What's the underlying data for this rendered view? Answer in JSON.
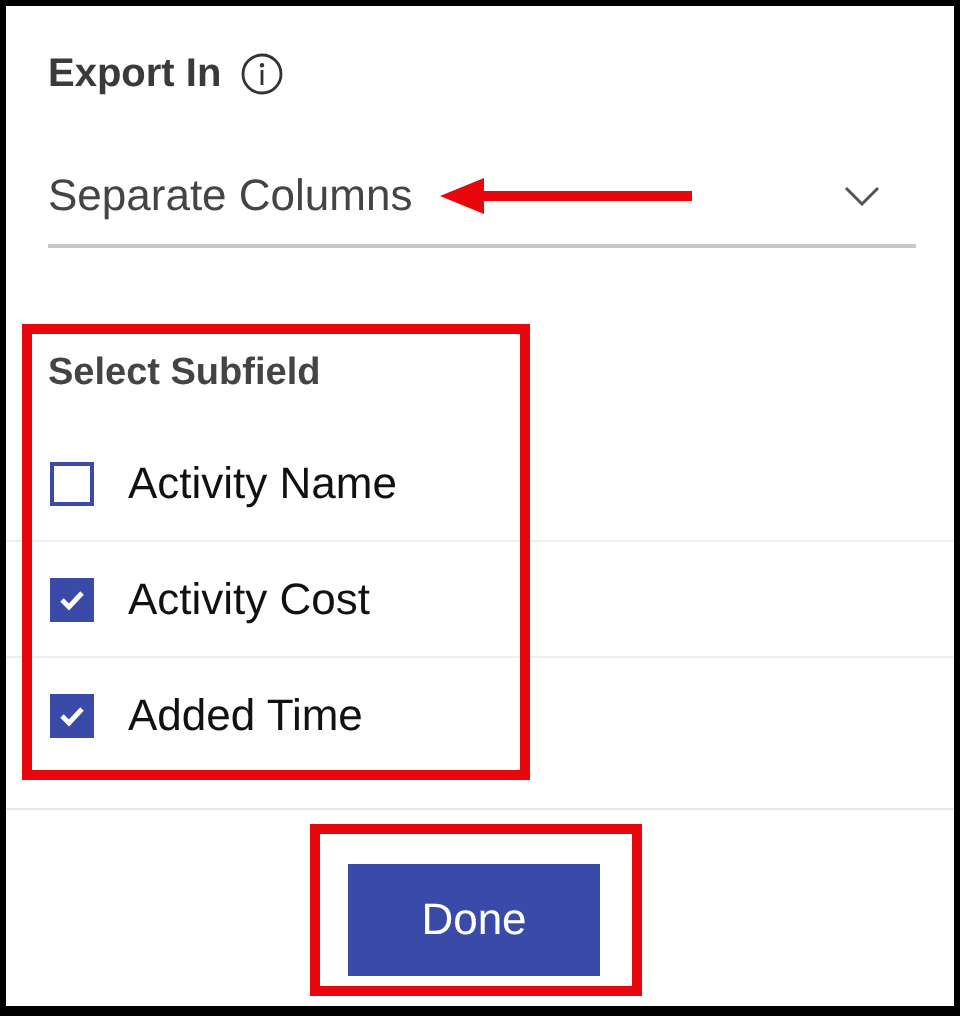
{
  "export_in": {
    "label": "Export In",
    "value": "Separate Columns"
  },
  "subfield": {
    "title": "Select Subfield",
    "options": [
      {
        "label": "Activity Name",
        "checked": false
      },
      {
        "label": "Activity Cost",
        "checked": true
      },
      {
        "label": "Added Time",
        "checked": true
      }
    ]
  },
  "buttons": [
    {
      "label": "Done"
    }
  ]
}
